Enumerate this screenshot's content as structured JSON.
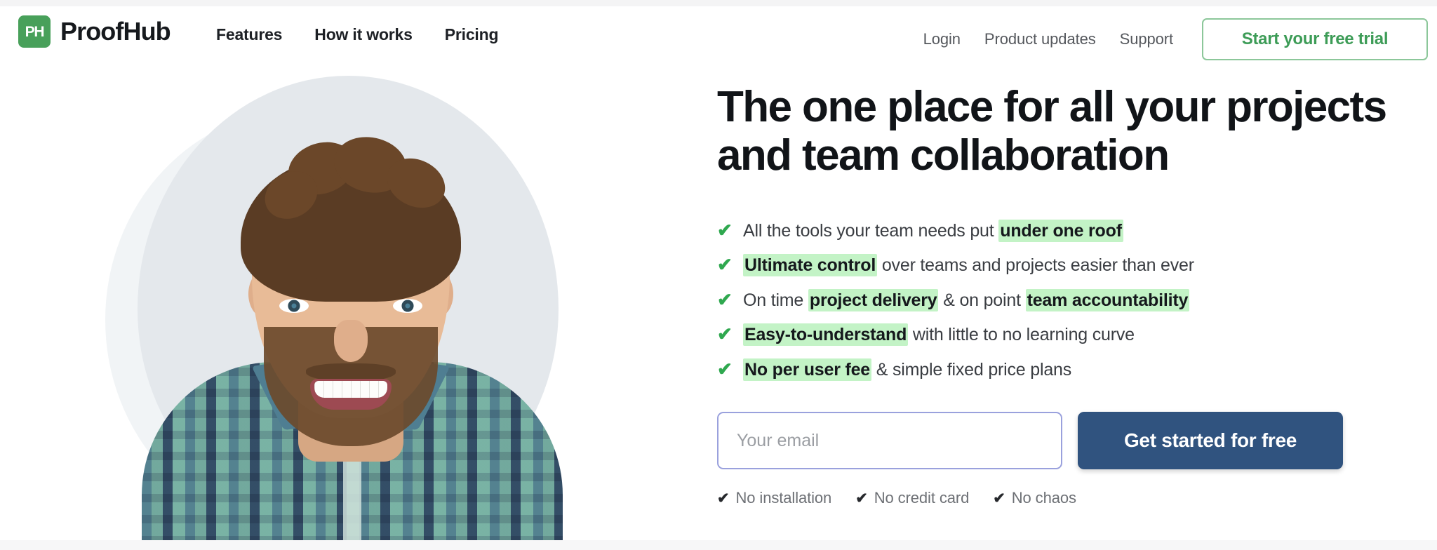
{
  "header": {
    "brand": {
      "mark_text": "PH",
      "name": "ProofHub",
      "mark_color": "#48a05a"
    },
    "nav_left": [
      {
        "label": "Features"
      },
      {
        "label": "How it works"
      },
      {
        "label": "Pricing"
      }
    ],
    "nav_right": [
      {
        "label": "Login"
      },
      {
        "label": "Product updates"
      },
      {
        "label": "Support"
      }
    ],
    "trial_button": {
      "label": "Start your free trial",
      "text_color": "#3d9c57",
      "border_color": "#8cc79a"
    }
  },
  "hero": {
    "headline": "The one place for all your projects and team collaboration",
    "check_glyph": "✔",
    "bullets": [
      {
        "parts": [
          {
            "text": "All the tools your team needs put ",
            "highlight": false
          },
          {
            "text": "under one roof",
            "highlight": true
          }
        ]
      },
      {
        "parts": [
          {
            "text": "Ultimate control",
            "highlight": true
          },
          {
            "text": " over teams and projects easier than ever",
            "highlight": false
          }
        ]
      },
      {
        "parts": [
          {
            "text": "On time ",
            "highlight": false
          },
          {
            "text": "project delivery",
            "highlight": true
          },
          {
            "text": " & on point ",
            "highlight": false
          },
          {
            "text": "team accountability",
            "highlight": true
          }
        ]
      },
      {
        "parts": [
          {
            "text": "Easy-to-understand",
            "highlight": true
          },
          {
            "text": " with little to no learning curve",
            "highlight": false
          }
        ]
      },
      {
        "parts": [
          {
            "text": "No per user fee",
            "highlight": true
          },
          {
            "text": " & simple fixed price plans",
            "highlight": false
          }
        ]
      }
    ],
    "highlight_color": "#c3f3c6",
    "check_color": "#2fa84f",
    "form": {
      "email_value": "",
      "email_placeholder": "Your email",
      "email_border_color": "#9aa1dd",
      "cta_label": "Get started for free",
      "cta_color": "#30537f"
    },
    "microcopy": {
      "check_glyph": "✔",
      "items": [
        {
          "label": "No installation"
        },
        {
          "label": "No credit card"
        },
        {
          "label": "No chaos"
        }
      ]
    },
    "image_alt": "Smiling man with curly brown hair and beard wearing a teal plaid shirt"
  }
}
